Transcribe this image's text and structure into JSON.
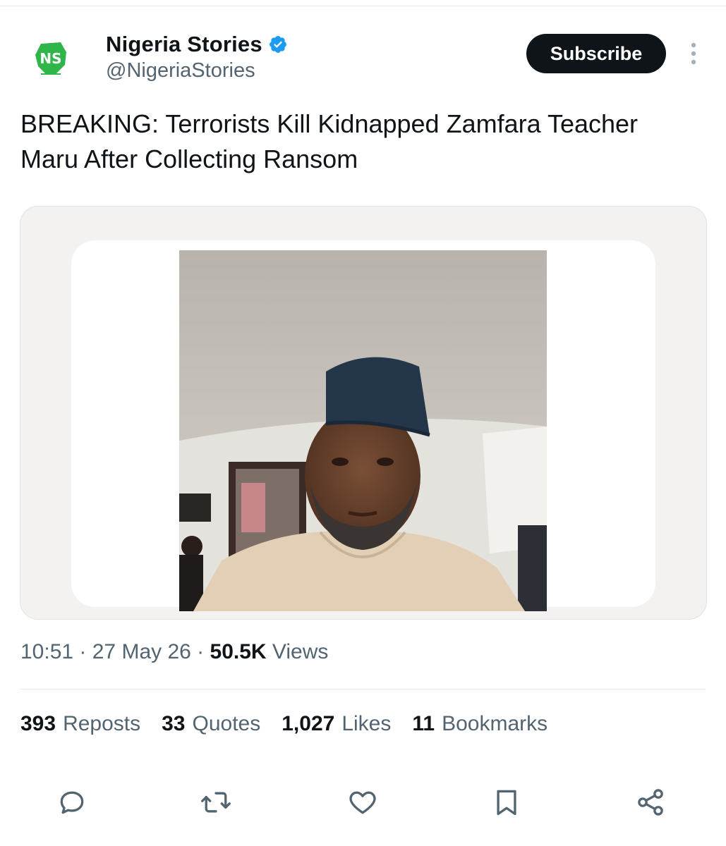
{
  "author": {
    "display_name": "Nigeria Stories",
    "handle": "@NigeriaStories",
    "verified": true,
    "avatar_text": "NS"
  },
  "header": {
    "subscribe_label": "Subscribe"
  },
  "tweet": {
    "text": "BREAKING: Terrorists Kill Kidnapped Zamfara Teacher Maru After Collecting Ransom"
  },
  "meta": {
    "time": "10:51",
    "date": "27 May 26",
    "views_count": "50.5K",
    "views_label": "Views",
    "separator": " · "
  },
  "stats": [
    {
      "count": "393",
      "label": "Reposts"
    },
    {
      "count": "33",
      "label": "Quotes"
    },
    {
      "count": "1,027",
      "label": "Likes"
    },
    {
      "count": "11",
      "label": "Bookmarks"
    }
  ],
  "actions": [
    "reply-icon",
    "repost-icon",
    "like-icon",
    "bookmark-icon",
    "share-icon"
  ],
  "colors": {
    "text_primary": "#0f1419",
    "text_secondary": "#536471",
    "verified_blue": "#1d9bf0",
    "brand_green": "#2fb54a"
  }
}
